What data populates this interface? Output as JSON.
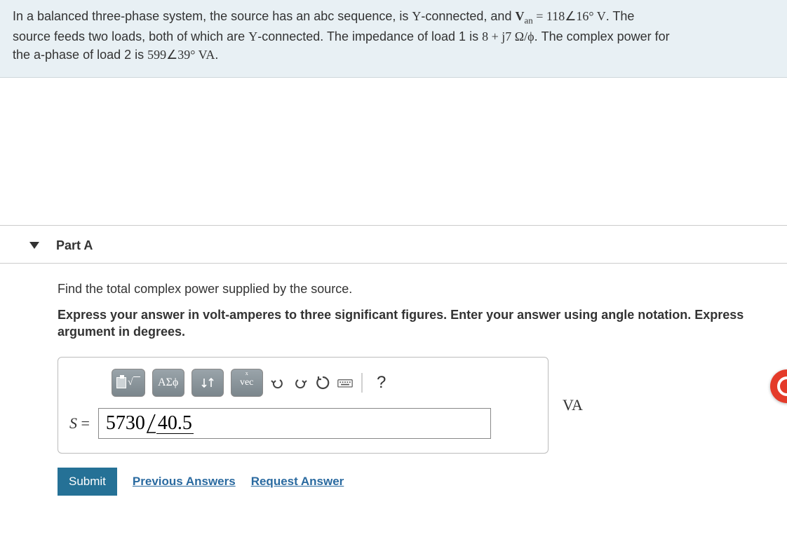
{
  "problem": {
    "line1a": "In a balanced three-phase system, the source has an abc sequence, is ",
    "Y1": "Y",
    "line1b": "-connected, and ",
    "Van": "V",
    "Van_sub": "an",
    "eq": " = ",
    "val1": "118",
    "ang1": "∠",
    "deg1": "16°",
    "unit1": " V",
    "line1c": ". The",
    "line2a": "source feeds two loads, both of which are ",
    "Y2": "Y",
    "line2b": "-connected. The impedance of load 1 is ",
    "imp": "8 + j7 Ω/ϕ",
    "line2c": ". The complex power for",
    "line3a": "the a-phase of load 2 is ",
    "val2": "599",
    "ang2": "∠",
    "deg2": "39°",
    "unit2": " VA",
    "line3b": "."
  },
  "part": {
    "title": "Part A",
    "instr1": "Find the total complex power supplied by the source.",
    "instr2": "Express your answer in volt-amperes to three significant figures. Enter your answer using angle notation. Express argument in degrees."
  },
  "toolbar": {
    "sqrt_label": "√",
    "greek_label": "ΑΣϕ",
    "subsup_label": "↓↑",
    "vec_label": "vec",
    "undo": "↶",
    "redo": "↷",
    "reset": "↻",
    "keyboard": "⌨",
    "help": "?"
  },
  "answer": {
    "label": "S",
    "equals": " = ",
    "mag": "5730",
    "angle": "40.5",
    "unit": "VA"
  },
  "submit": {
    "btn": "Submit",
    "prev": "Previous Answers",
    "req": "Request Answer"
  }
}
